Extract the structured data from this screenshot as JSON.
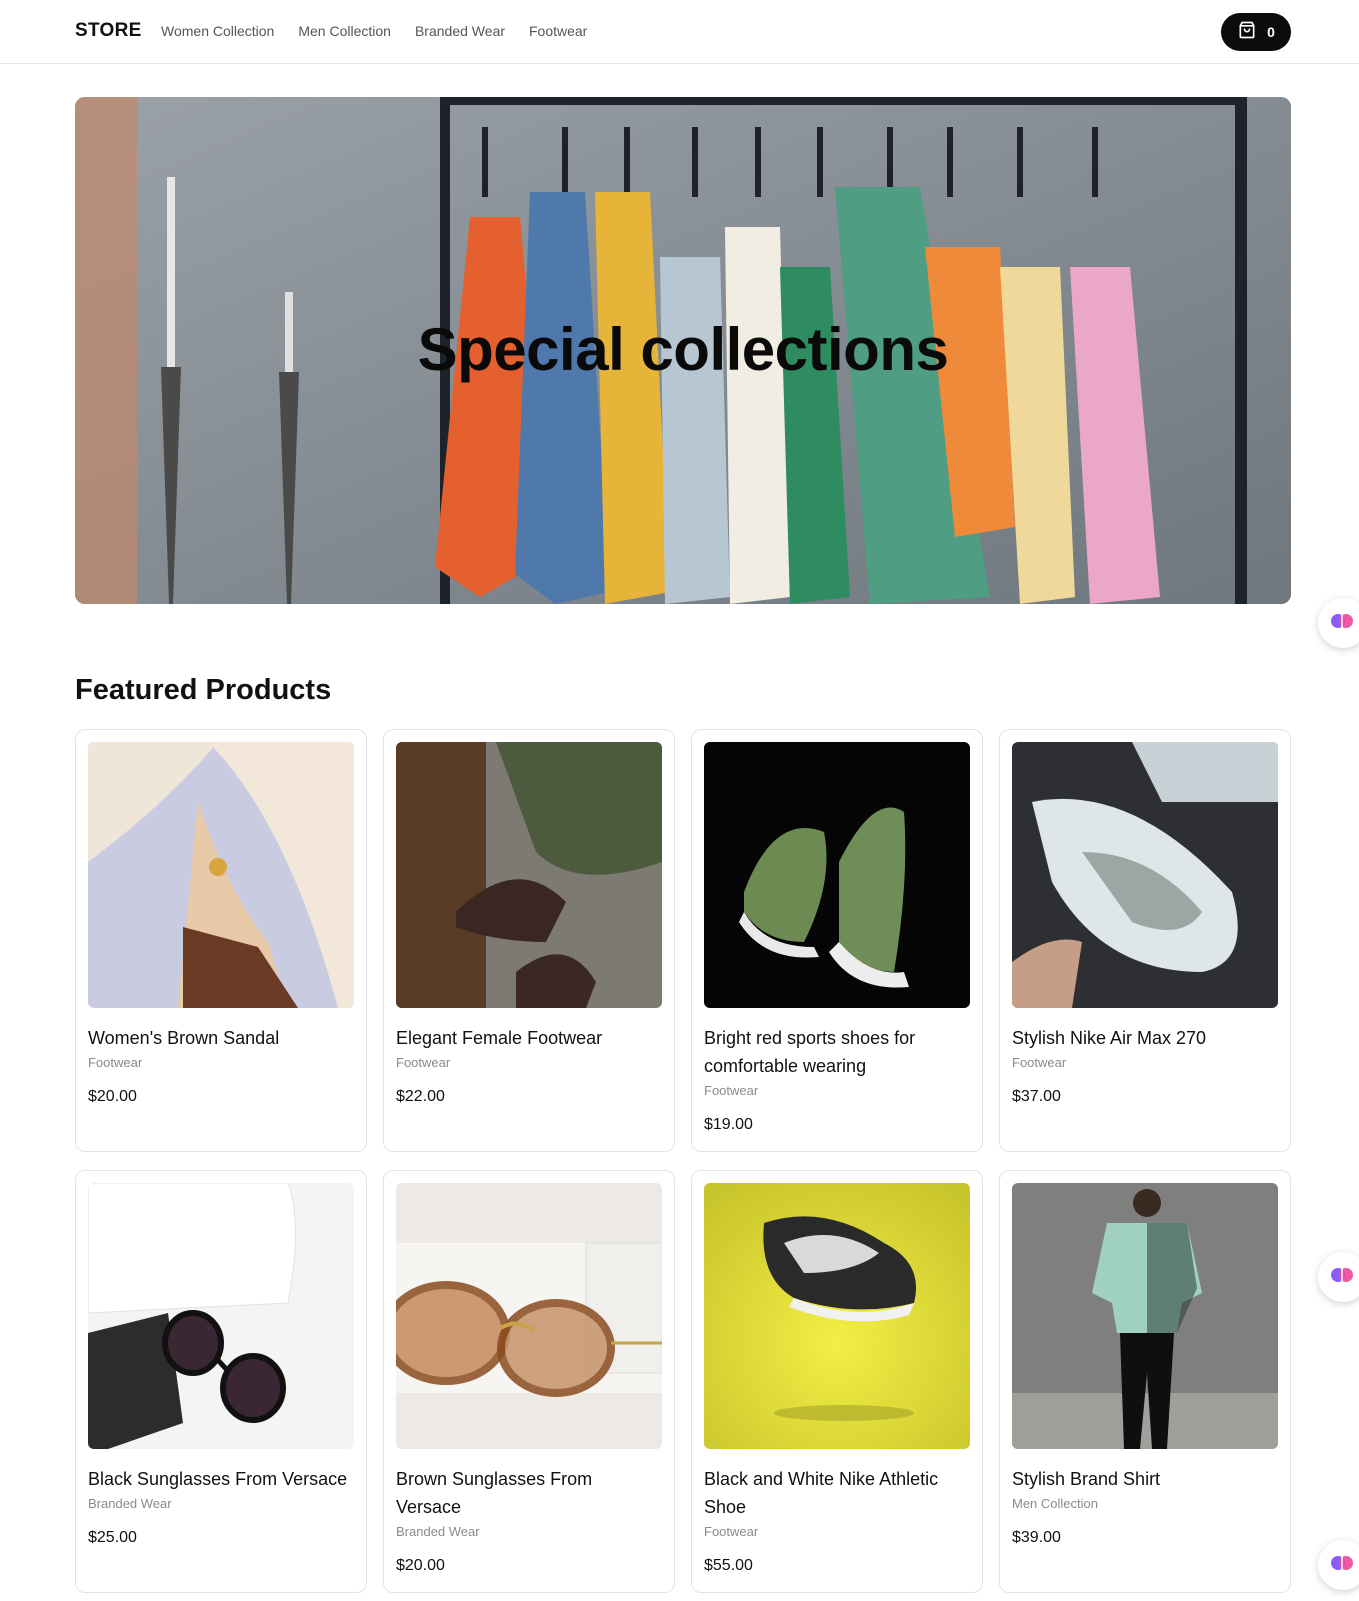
{
  "header": {
    "brand": "STORE",
    "nav": [
      "Women Collection",
      "Men Collection",
      "Branded Wear",
      "Footwear"
    ],
    "cart_count": "0"
  },
  "hero": {
    "title": "Special collections"
  },
  "featured": {
    "title": "Featured Products",
    "products": [
      {
        "name": "Women's Brown Sandal",
        "category": "Footwear",
        "price": "$20.00"
      },
      {
        "name": "Elegant Female Footwear",
        "category": "Footwear",
        "price": "$22.00"
      },
      {
        "name": "Bright red sports shoes for comfortable wearing",
        "category": "Footwear",
        "price": "$19.00"
      },
      {
        "name": "Stylish Nike Air Max 270",
        "category": "Footwear",
        "price": "$37.00"
      },
      {
        "name": "Black Sunglasses From Versace",
        "category": "Branded Wear",
        "price": "$25.00"
      },
      {
        "name": "Brown Sunglasses From Versace",
        "category": "Branded Wear",
        "price": "$20.00"
      },
      {
        "name": "Black and White Nike Athletic Shoe",
        "category": "Footwear",
        "price": "$55.00"
      },
      {
        "name": "Stylish Brand Shirt",
        "category": "Men Collection",
        "price": "$39.00"
      }
    ]
  },
  "icons": {
    "cart": "shopping-bag-icon",
    "floating": "brain-assistant-icon"
  },
  "colors": {
    "accent": "#0b0b0b",
    "muted_text": "#8a8a8a",
    "border": "#e3e3e3"
  }
}
